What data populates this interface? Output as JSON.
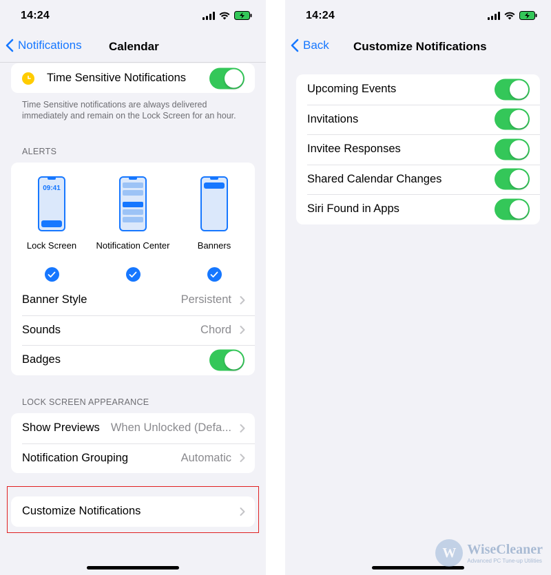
{
  "left": {
    "status": {
      "time": "14:24"
    },
    "nav": {
      "back_label": "Notifications",
      "title": "Calendar"
    },
    "time_sensitive": {
      "label": "Time Sensitive Notifications",
      "enabled": true,
      "footnote": "Time Sensitive notifications are always delivered immediately and remain on the Lock Screen for an hour."
    },
    "alerts": {
      "header": "ALERTS",
      "styles": [
        {
          "label": "Lock Screen",
          "preview_time": "09:41",
          "checked": true
        },
        {
          "label": "Notification Center",
          "checked": true
        },
        {
          "label": "Banners",
          "checked": true
        }
      ],
      "banner_style": {
        "label": "Banner Style",
        "value": "Persistent"
      },
      "sounds": {
        "label": "Sounds",
        "value": "Chord"
      },
      "badges": {
        "label": "Badges",
        "enabled": true
      }
    },
    "lock_screen": {
      "header": "LOCK SCREEN APPEARANCE",
      "show_previews": {
        "label": "Show Previews",
        "value": "When Unlocked (Defa..."
      },
      "grouping": {
        "label": "Notification Grouping",
        "value": "Automatic"
      }
    },
    "customize": {
      "label": "Customize Notifications"
    }
  },
  "right": {
    "status": {
      "time": "14:24"
    },
    "nav": {
      "back_label": "Back",
      "title": "Customize Notifications"
    },
    "items": [
      {
        "label": "Upcoming Events",
        "enabled": true
      },
      {
        "label": "Invitations",
        "enabled": true
      },
      {
        "label": "Invitee Responses",
        "enabled": true
      },
      {
        "label": "Shared Calendar Changes",
        "enabled": true
      },
      {
        "label": "Siri Found in Apps",
        "enabled": true
      }
    ]
  },
  "watermark": {
    "name": "WiseCleaner",
    "tagline": "Advanced PC Tune-up Utilities",
    "logo_letter": "W"
  },
  "colors": {
    "accent": "#1677ff",
    "toggle_on": "#34c759",
    "highlight": "#e02020",
    "background": "#f2f2f7"
  }
}
